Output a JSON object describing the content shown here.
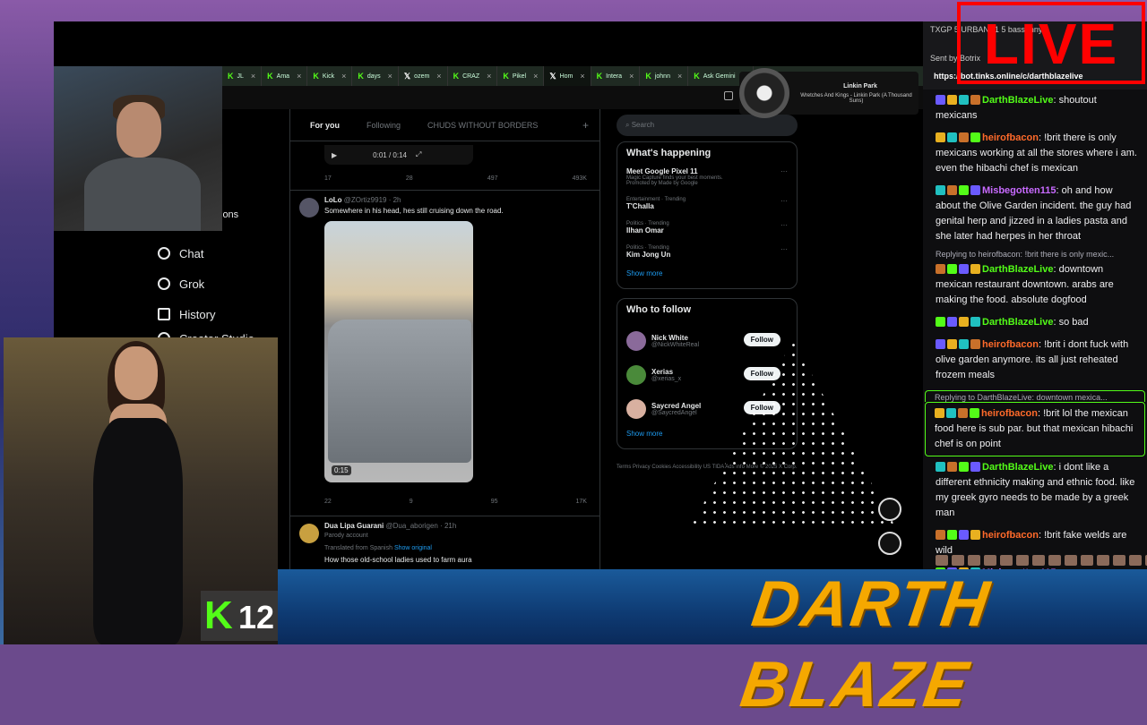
{
  "browser": {
    "tabs": [
      {
        "label": "JL",
        "kind": "k"
      },
      {
        "label": "Ama",
        "kind": "k"
      },
      {
        "label": "Kick",
        "kind": "k"
      },
      {
        "label": "days",
        "kind": "k"
      },
      {
        "label": "ozem",
        "kind": "x"
      },
      {
        "label": "CRAZ",
        "kind": "k"
      },
      {
        "label": "Pikel",
        "kind": "k"
      },
      {
        "label": "Hom",
        "kind": "x"
      },
      {
        "label": "Intera",
        "kind": "k"
      },
      {
        "label": "johnn",
        "kind": "k"
      },
      {
        "label": "Ask Gemini",
        "kind": "k"
      }
    ]
  },
  "now_playing": {
    "artist": "Linkin Park",
    "track": "Wretches And Kings - Linkin Park (A Thousand Suns)"
  },
  "nav": {
    "partial": "ions",
    "items": [
      {
        "label": "Chat"
      },
      {
        "label": "Grok"
      },
      {
        "label": "History"
      },
      {
        "label": "Creator Studio"
      }
    ]
  },
  "feed": {
    "tabs": [
      "For you",
      "Following",
      "CHUDS WITHOUT BORDERS"
    ],
    "video_time": "0:01 / 0:14",
    "top_stats": [
      "17",
      "28",
      "497",
      "493K"
    ],
    "post1": {
      "name": "LoLo",
      "handle": "@ZOrtiz9919 · 2h",
      "text": "Somewhere in his head, hes still cruising down the road.",
      "duration": "0:15",
      "stats": [
        "22",
        "9",
        "95",
        "17K"
      ]
    },
    "post2": {
      "name": "Dua Lipa Guarani",
      "handle": "@Dua_aborigen · 21h",
      "tag": "Parody account",
      "translated": "Translated from Spanish",
      "show_original": "Show original",
      "text": "How those old-school ladies used to farm aura"
    }
  },
  "sidebar": {
    "search_placeholder": "Search",
    "happening_title": "What's happening",
    "trends": [
      {
        "cat": "",
        "title": "Meet Google Pixel 11",
        "sub": "Magic Capture finds your best moments.",
        "promo": "Promoted by Made by Google"
      },
      {
        "cat": "Entertainment · Trending",
        "title": "T'Challa"
      },
      {
        "cat": "Politics · Trending",
        "title": "Ilhan Omar"
      },
      {
        "cat": "Politics · Trending",
        "title": "Kim Jong Un"
      }
    ],
    "show_more": "Show more",
    "who_title": "Who to follow",
    "who": [
      {
        "name": "Nick White",
        "handle": "@NickWhiteReal"
      },
      {
        "name": "Xerias",
        "handle": "@xerias_x"
      },
      {
        "name": "Saycred Angel",
        "handle": "@SaycredAngel"
      }
    ],
    "follow_label": "Follow",
    "footer": "Terms  Privacy  Cookies  Accessibility  US TIDA  Ads info  More  © 2025 X Corp."
  },
  "chat": {
    "top1": "TXGP 5   URBANA1 5   bassunny",
    "top2": "Sent by  Botrix",
    "link": "https://bot.tinks.online/c/darthblazelive",
    "messages": [
      {
        "user": "DarthBlazeLive",
        "color": "#53fc18",
        "text": "shoutout mexicans"
      },
      {
        "user": "heirofbacon",
        "color": "#ff6a2a",
        "text": "!brit there is only mexicans working at all the stores where i am. even the hibachi chef is mexican"
      },
      {
        "user": "Misbegotten115",
        "color": "#c86aff",
        "text": "oh and how about the Olive Garden incident. the guy had genital herp and jizzed in a ladies pasta and she later had herpes in her throat"
      },
      {
        "reply": "Replying to heirofbacon: !brit there is only mexic...",
        "user": "DarthBlazeLive",
        "color": "#53fc18",
        "text": "downtown mexican restaurant downtown. arabs are making the food. absolute dogfood"
      },
      {
        "user": "DarthBlazeLive",
        "color": "#53fc18",
        "text": "so bad"
      },
      {
        "user": "heirofbacon",
        "color": "#ff6a2a",
        "text": "!brit i dont fuck with olive garden anymore. its all just reheated frozem meals"
      },
      {
        "reply": "Replying to DarthBlazeLive: downtown mexica...",
        "user": "heirofbacon",
        "color": "#ff6a2a",
        "text": "!brit lol the mexican food here is sub par. but that mexican hibachi chef is on point",
        "highlight": true
      },
      {
        "user": "DarthBlazeLive",
        "color": "#53fc18",
        "text": "i dont like a different ethnicity making and ethnic food. like my greek gyro needs to be made by a greek man"
      },
      {
        "user": "heirofbacon",
        "color": "#ff6a2a",
        "text": "!brit fake welds are wild"
      },
      {
        "user": "Misbegotten115",
        "color": "#c86aff",
        "text": ""
      }
    ]
  },
  "live_label": "LIVE",
  "brand": "DARTH BLAZE",
  "kick": {
    "logo": "K",
    "count": "12"
  }
}
